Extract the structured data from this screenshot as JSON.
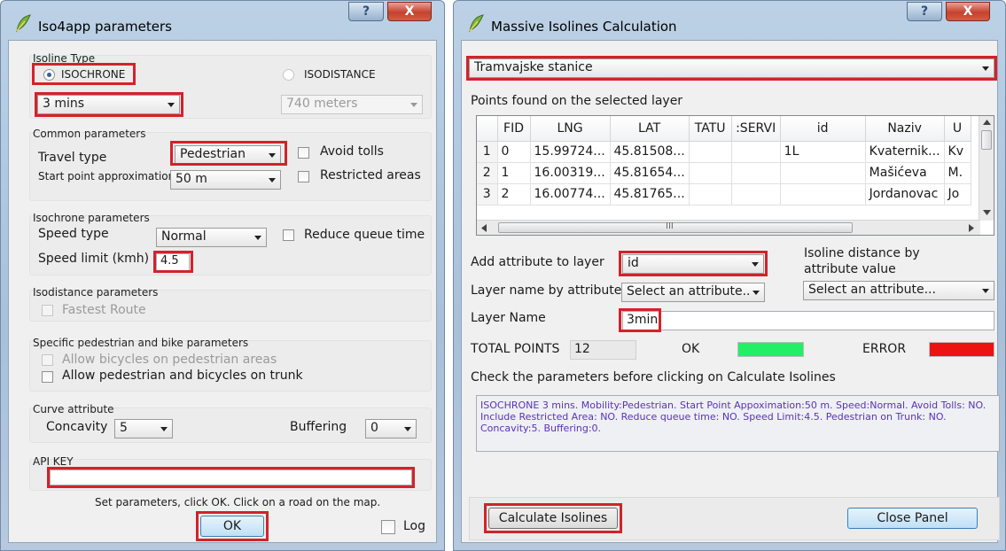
{
  "left": {
    "title": "Iso4app parameters",
    "titlebar_buttons": {
      "help": "?",
      "close": "X"
    },
    "isoline_type": {
      "group": "Isoline Type",
      "isochrone": "ISOCHRONE",
      "isodistance": "ISODISTANCE",
      "time_value": "3 mins",
      "distance_value": "740 meters"
    },
    "common": {
      "group": "Common parameters",
      "travel_type_label": "Travel type",
      "travel_type_value": "Pedestrian",
      "avoid_tolls": "Avoid tolls",
      "start_point_label": "Start point approximation",
      "start_point_value": "50 m",
      "restricted_areas": "Restricted areas"
    },
    "isochrone": {
      "group": "Isochrone parameters",
      "speed_type_label": "Speed type",
      "speed_type_value": "Normal",
      "reduce_queue": "Reduce queue time",
      "speed_limit_label": "Speed limit (kmh)",
      "speed_limit_value": "4.5"
    },
    "isodistance": {
      "group": "Isodistance parameters",
      "fastest_route": "Fastest Route"
    },
    "pedbike": {
      "group": "Specific pedestrian and bike parameters",
      "allow_bicycles": "Allow bicycles on pedestrian areas",
      "allow_trunk": "Allow pedestrian and bicycles on trunk"
    },
    "curve": {
      "group": "Curve attribute",
      "concavity_label": "Concavity",
      "concavity_value": "5",
      "buffering_label": "Buffering",
      "buffering_value": "0"
    },
    "api": {
      "group": "API KEY",
      "value": ""
    },
    "instruction": "Set parameters, click OK. Click on a road on the map.",
    "ok": "OK",
    "log": "Log"
  },
  "right": {
    "title": "Massive Isolines Calculation",
    "titlebar_buttons": {
      "help": "?",
      "close": "X"
    },
    "layer_value": "Tramvajske stanice",
    "points_label": "Points found on the selected layer",
    "table": {
      "headers": [
        "FID",
        "LNG",
        "LAT",
        "TATU",
        ":SERVI",
        "id",
        "Naziv",
        "U"
      ],
      "rows": [
        {
          "n": "1",
          "cells": [
            "0",
            "15.99724...",
            "45.81508...",
            "",
            "",
            "1L",
            "Kvaternik...",
            "Kv"
          ]
        },
        {
          "n": "2",
          "cells": [
            "1",
            "16.00319...",
            "45.81654...",
            "",
            "",
            "",
            "Mašićeva",
            "M."
          ]
        },
        {
          "n": "3",
          "cells": [
            "2",
            "16.00774...",
            "45.81765...",
            "",
            "",
            "",
            "Jordanovac",
            "Jo"
          ]
        }
      ],
      "scroll_glyph": "III"
    },
    "add_attr_label": "Add attribute to layer",
    "add_attr_value": "id",
    "isoline_dist_label_1": "Isoline distance by",
    "isoline_dist_label_2": "attribute value",
    "isoline_dist_value": "Select an attribute...",
    "layer_name_by_attr_label": "Layer name by attribute",
    "layer_name_by_attr_value": "Select an attribute..",
    "layer_name_label": "Layer Name",
    "layer_name_value": "3min",
    "total_points_label": "TOTAL POINTS",
    "total_points_value": "12",
    "ok_label": "OK",
    "error_label": "ERROR",
    "ok_color": "#22ee66",
    "error_color": "#ee1111",
    "check_label": "Check the parameters before clicking on Calculate Isolines",
    "summary": "ISOCHRONE 3 mins. Mobility:Pedestrian. Start Point Appoximation:50 m. Speed:Normal. Avoid Tolls: NO.  Include Restricted Area: NO.  Reduce queue time: NO.  Speed Limit:4.5. Pedestrian on Trunk: NO. Concavity:5.  Buffering:0.",
    "calculate": "Calculate Isolines",
    "close_panel": "Close Panel"
  }
}
